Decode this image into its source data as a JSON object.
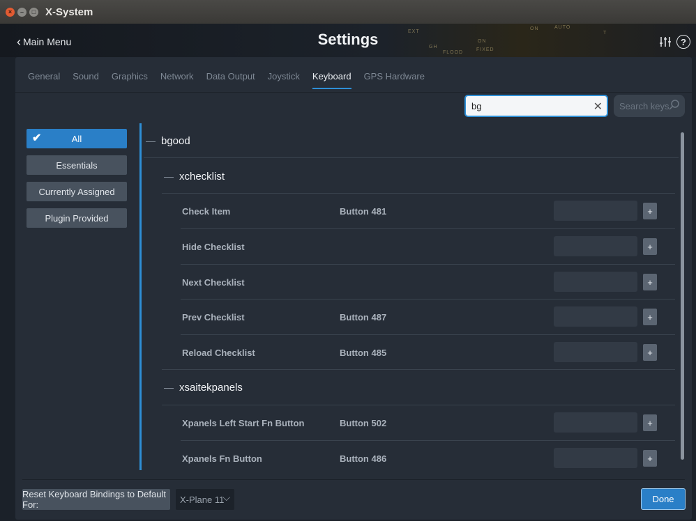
{
  "window": {
    "title": "X-System"
  },
  "header": {
    "back_label": "Main Menu",
    "title": "Settings"
  },
  "tabs": [
    {
      "label": "General"
    },
    {
      "label": "Sound"
    },
    {
      "label": "Graphics"
    },
    {
      "label": "Network"
    },
    {
      "label": "Data Output"
    },
    {
      "label": "Joystick"
    },
    {
      "label": "Keyboard",
      "active": true
    },
    {
      "label": "GPS Hardware"
    }
  ],
  "search": {
    "value": "bg",
    "keys_placeholder": "Search keys"
  },
  "filters": [
    {
      "label": "All",
      "active": true
    },
    {
      "label": "Essentials"
    },
    {
      "label": "Currently Assigned"
    },
    {
      "label": "Plugin Provided"
    }
  ],
  "list": {
    "root": "bgood",
    "groups": [
      {
        "name": "xchecklist",
        "rows": [
          {
            "command": "Check Item",
            "binding": "Button 481"
          },
          {
            "command": "Hide Checklist",
            "binding": ""
          },
          {
            "command": "Next Checklist",
            "binding": ""
          },
          {
            "command": "Prev Checklist",
            "binding": "Button 487"
          },
          {
            "command": "Reload Checklist",
            "binding": "Button 485"
          }
        ]
      },
      {
        "name": "xsaitekpanels",
        "rows": [
          {
            "command": "Xpanels Left Start Fn Button",
            "binding": "Button 502"
          },
          {
            "command": "Xpanels Fn Button",
            "binding": "Button 486"
          }
        ]
      }
    ],
    "plus_label": "+"
  },
  "footer": {
    "reset_label": "Reset Keyboard Bindings to Default For:",
    "version": "X-Plane 11",
    "done_label": "Done"
  },
  "colors": {
    "accent": "#2e8fd6",
    "panel": "#262d37",
    "button": "#48525e"
  }
}
